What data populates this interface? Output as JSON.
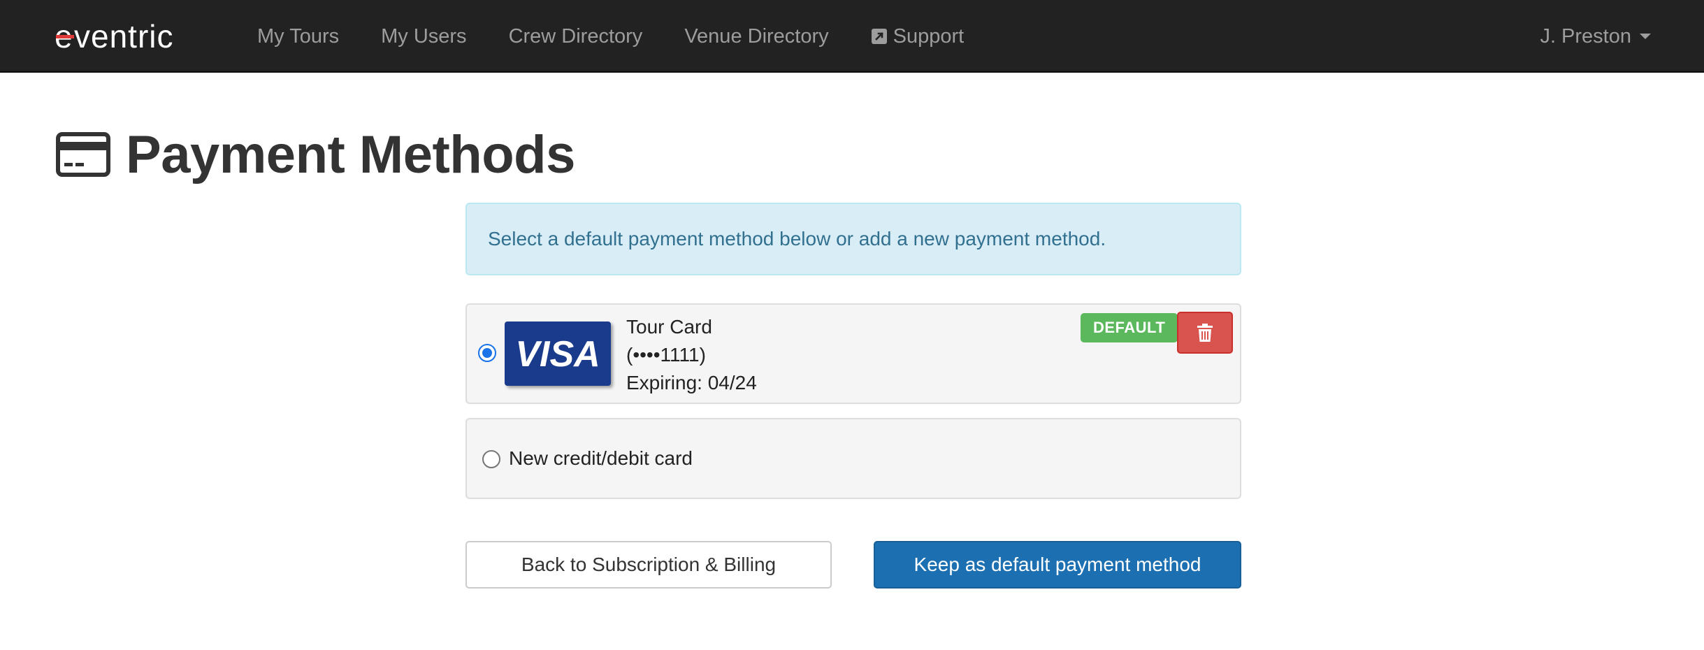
{
  "app": {
    "brand": "eventric"
  },
  "navbar": {
    "links": [
      {
        "label": "My Tours"
      },
      {
        "label": "My Users"
      },
      {
        "label": "Crew Directory"
      },
      {
        "label": "Venue Directory"
      },
      {
        "label": "Support",
        "icon": "external-link-icon"
      }
    ],
    "user": "J. Preston"
  },
  "page": {
    "title": "Payment Methods",
    "title_icon": "credit-card-icon"
  },
  "alert": {
    "text": "Select a default payment method below or add a new payment method."
  },
  "payment_methods": {
    "card": {
      "selected": true,
      "brand": "VISA",
      "name": "Tour Card",
      "number": "(••••1111)",
      "expiry": "Expiring: 04/24",
      "badge": "DEFAULT",
      "delete_icon": "trash-icon"
    },
    "new_card": {
      "selected": false,
      "label": "New credit/debit card"
    }
  },
  "actions": {
    "back_label": "Back to Subscription & Billing",
    "primary_label": "Keep as default payment method"
  },
  "colors": {
    "navbar_bg": "#222222",
    "alert_bg": "#d9edf7",
    "alert_text": "#31708f",
    "default_badge": "#5cb85c",
    "delete_button": "#d9534f",
    "primary_button": "#1c6fb0",
    "visa_blue": "#1a3a8b"
  }
}
